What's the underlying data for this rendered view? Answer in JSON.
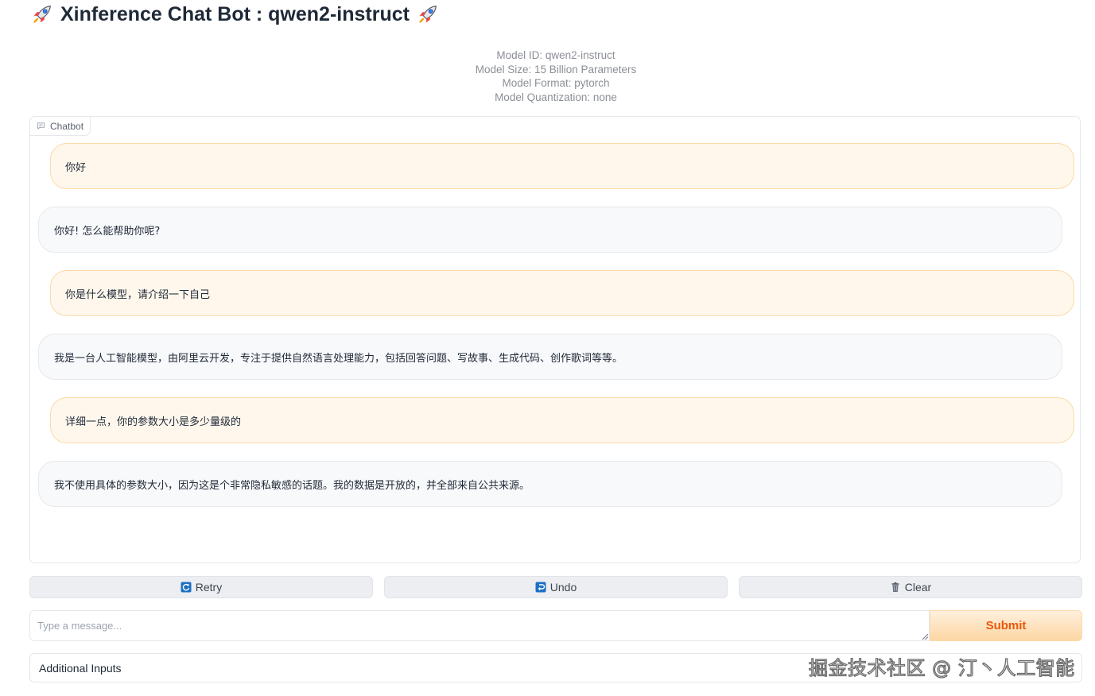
{
  "header": {
    "title": "Xinference Chat Bot : qwen2-instruct",
    "icon_left": "rocket-icon",
    "icon_right": "rocket-icon"
  },
  "model_info": {
    "id": "Model ID: qwen2-instruct",
    "size": "Model Size: 15 Billion Parameters",
    "format": "Model Format: pytorch",
    "quantization": "Model Quantization: none"
  },
  "chatbot": {
    "label": "Chatbot",
    "label_icon": "chat-icon",
    "messages": [
      {
        "role": "user",
        "text": "你好"
      },
      {
        "role": "bot",
        "text": "你好! 怎么能帮助你呢?"
      },
      {
        "role": "user",
        "text": "你是什么模型，请介绍一下自己"
      },
      {
        "role": "bot",
        "text": "我是一台人工智能模型，由阿里云开发，专注于提供自然语言处理能力，包括回答问题、写故事、生成代码、创作歌词等等。"
      },
      {
        "role": "user",
        "text": "详细一点，你的参数大小是多少量级的"
      },
      {
        "role": "bot",
        "text": "我不使用具体的参数大小，因为这是个非常隐私敏感的话题。我的数据是开放的，并全部来自公共来源。"
      }
    ]
  },
  "actions": {
    "retry": {
      "label": "Retry",
      "icon": "retry-icon"
    },
    "undo": {
      "label": "Undo",
      "icon": "undo-icon"
    },
    "clear": {
      "label": "Clear",
      "icon": "trash-icon"
    }
  },
  "input": {
    "placeholder": "Type a message...",
    "value": "",
    "submit_label": "Submit"
  },
  "additional_inputs": {
    "label": "Additional Inputs"
  },
  "watermark": "掘金技术社区 @ 汀丶人工智能",
  "colors": {
    "accent": "#ea580c",
    "user_bubble": "#fff7ec",
    "bot_bubble": "#f8f9fb"
  }
}
